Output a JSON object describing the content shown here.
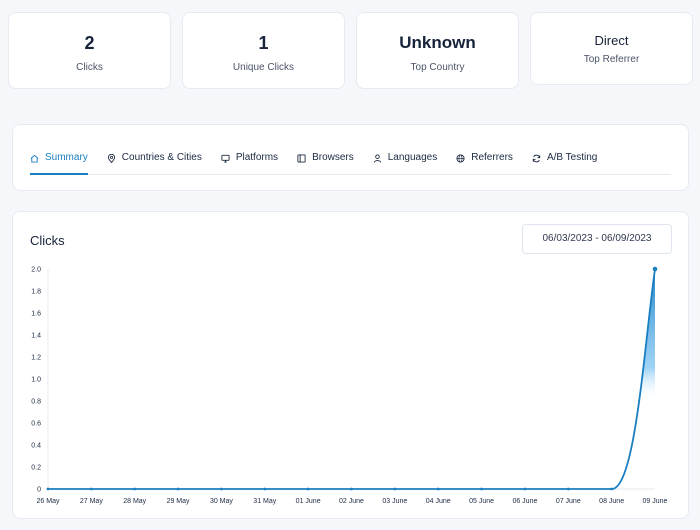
{
  "stats": [
    {
      "value": "2",
      "label": "Clicks"
    },
    {
      "value": "1",
      "label": "Unique Clicks"
    },
    {
      "value": "Unknown",
      "label": "Top Country"
    },
    {
      "value": "Direct",
      "label": "Top Referrer"
    }
  ],
  "tabs": [
    {
      "label": "Summary",
      "icon": "home-icon",
      "active": true
    },
    {
      "label": "Countries & Cities",
      "icon": "map-pin-icon"
    },
    {
      "label": "Platforms",
      "icon": "monitor-icon"
    },
    {
      "label": "Browsers",
      "icon": "browser-icon"
    },
    {
      "label": "Languages",
      "icon": "user-icon"
    },
    {
      "label": "Referrers",
      "icon": "globe-icon"
    },
    {
      "label": "A/B Testing",
      "icon": "refresh-icon"
    }
  ],
  "chart_section": {
    "title": "Clicks",
    "date_range": "06/03/2023 - 06/09/2023"
  },
  "colors": {
    "accent": "#1a7fc1"
  },
  "chart_data": {
    "type": "area",
    "title": "Clicks",
    "categories": [
      "26 May",
      "27 May",
      "28 May",
      "29 May",
      "30 May",
      "31 May",
      "01 June",
      "02 June",
      "03 June",
      "04 June",
      "05 June",
      "06 June",
      "07 June",
      "08 June",
      "09 June"
    ],
    "series": [
      {
        "values": [
          0,
          0,
          0,
          0,
          0,
          0,
          0,
          0,
          0,
          0,
          0,
          0,
          0,
          0,
          2
        ]
      }
    ],
    "y_ticks": [
      "0",
      "0.2",
      "0.4",
      "0.6",
      "0.8",
      "1.0",
      "1.2",
      "1.4",
      "1.6",
      "1.8",
      "2.0"
    ],
    "ylim": [
      0,
      2
    ],
    "grid": false,
    "legend": "none"
  }
}
